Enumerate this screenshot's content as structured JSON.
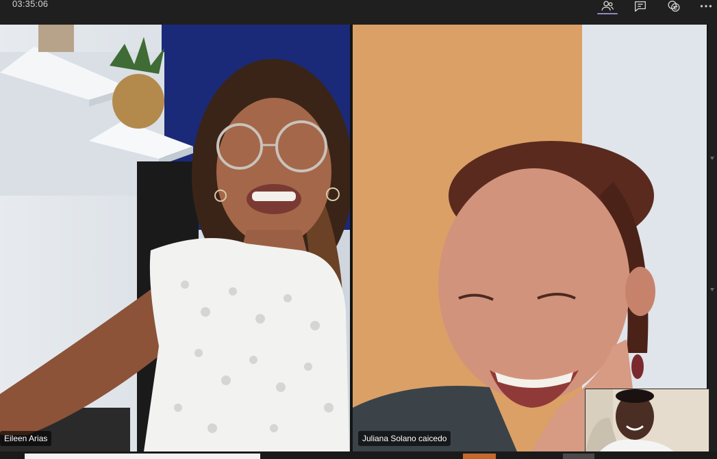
{
  "meeting": {
    "elapsed_time": "03:35:06"
  },
  "toolbar": {
    "people_icon": "people-icon",
    "chat_icon": "chat-icon",
    "reactions_icon": "reactions-icon",
    "more_icon": "more-icon"
  },
  "participants": [
    {
      "name": "Eileen Arias"
    },
    {
      "name": "Juliana Solano caicedo"
    }
  ],
  "colors": {
    "accent": "#8b8cc7",
    "background": "#1f1f1f"
  }
}
